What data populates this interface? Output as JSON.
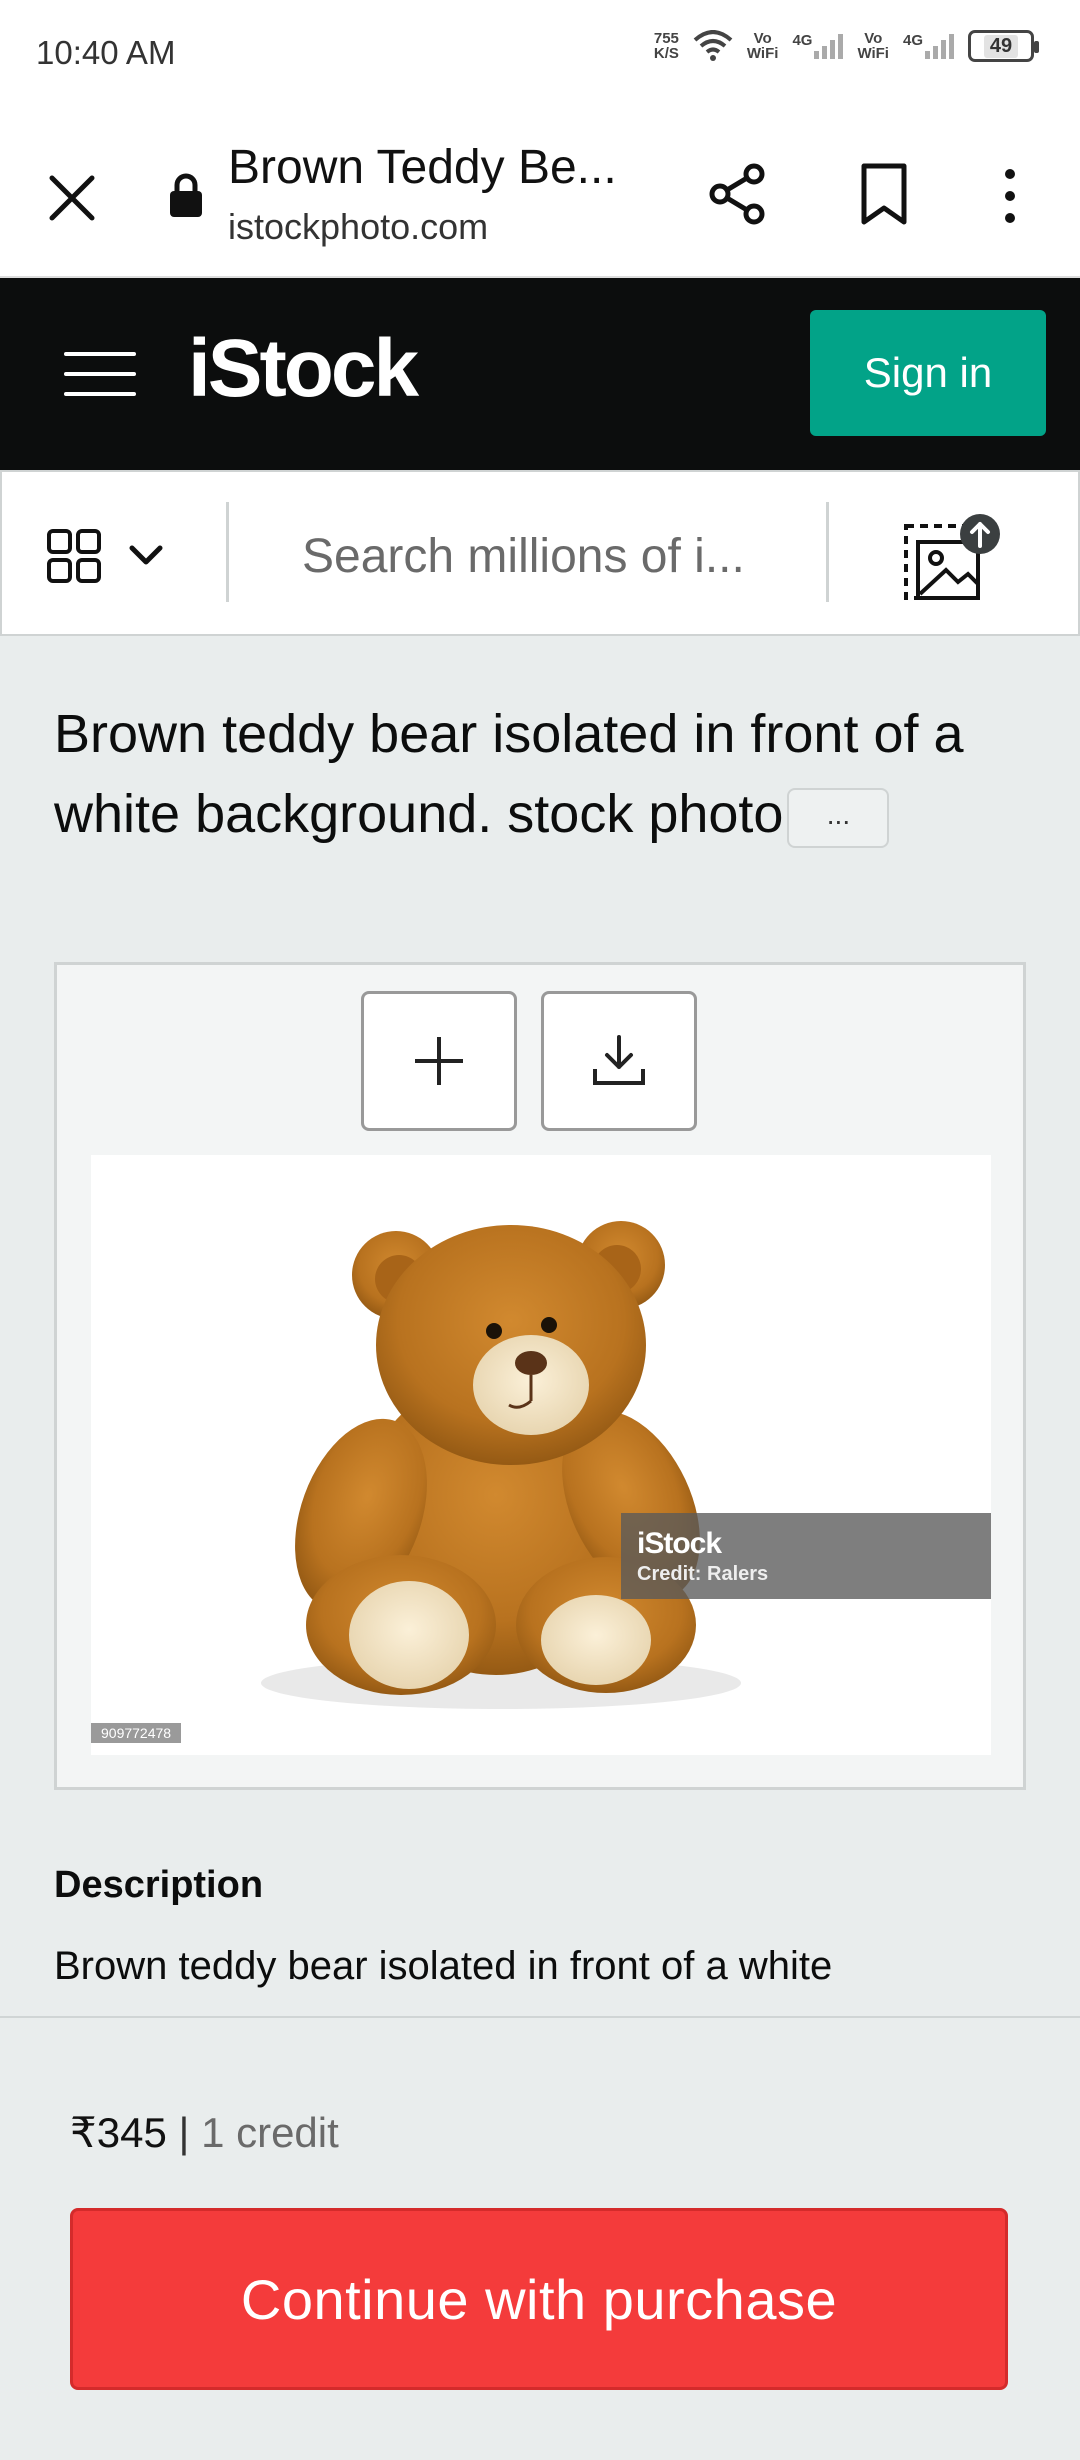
{
  "status_bar": {
    "time": "10:40 AM",
    "net_speed_value": "755",
    "net_speed_unit": "K/S",
    "vowifi_label_1": "Vo\nWiFi",
    "network_1": "4G",
    "vowifi_label_2": "Vo\nWiFi",
    "network_2": "4G",
    "battery": "49"
  },
  "browser": {
    "page_title": "Brown Teddy Be...",
    "url": "istockphoto.com"
  },
  "header": {
    "logo": "iStock",
    "sign_in_label": "Sign in"
  },
  "search": {
    "placeholder": "Search millions of i..."
  },
  "photo": {
    "title": "Brown teddy bear isolated in front of a white background. stock photo",
    "more_label": "...",
    "watermark_logo": "iStock",
    "watermark_credit": "Credit: Ralers",
    "image_id": "909772478"
  },
  "description": {
    "heading": "Description",
    "text": "Brown teddy bear isolated in front of a white"
  },
  "purchase": {
    "price": "₹345",
    "separator": "|",
    "credits": "1 credit",
    "button_label": "Continue with purchase"
  },
  "colors": {
    "brand_green": "#02a388",
    "purchase_red": "#f43b3b",
    "header_black": "#0c0d0d"
  }
}
